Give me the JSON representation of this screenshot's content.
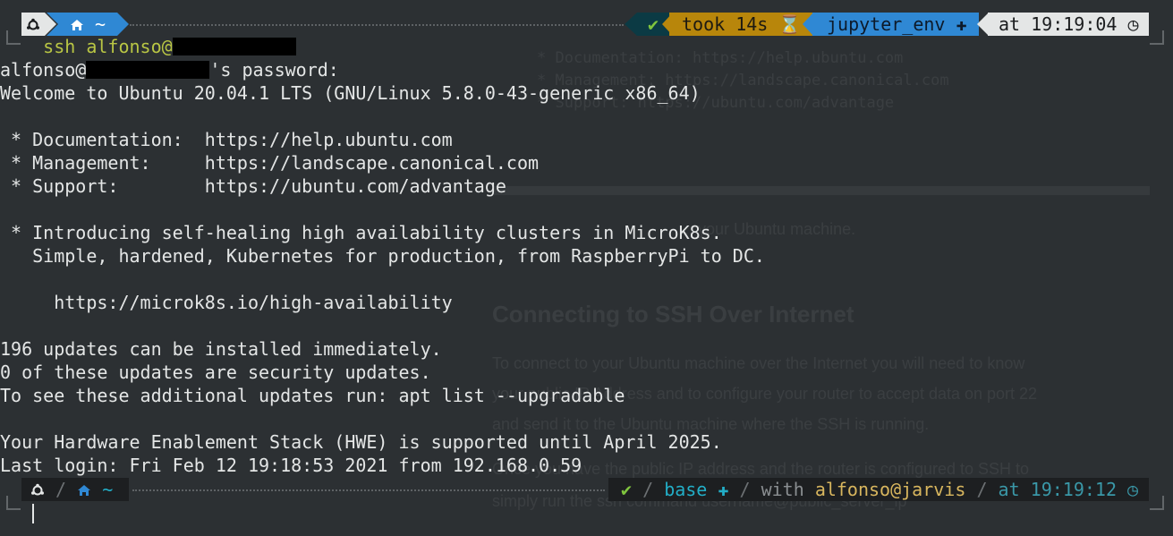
{
  "prompt_top": {
    "os_icon": "ubuntu-icon",
    "home_icon": "home-icon",
    "cwd": "~",
    "status_mark": "✔",
    "took_label": "took 14s",
    "hourglass_icon": "⌛",
    "env_name": "jupyter_env",
    "python_icon": "✚",
    "time_label": "at 19:19:04",
    "clock_icon": "◷"
  },
  "command": {
    "text": "ssh alfonso@",
    "redacted": true
  },
  "output": {
    "password_prefix": "alfonso@",
    "password_suffix": "'s password:",
    "welcome": "Welcome to Ubuntu 20.04.1 LTS (GNU/Linux 5.8.0-43-generic x86_64)",
    "links": [
      {
        "label": " * Documentation:  ",
        "url": "https://help.ubuntu.com"
      },
      {
        "label": " * Management:     ",
        "url": "https://landscape.canonical.com"
      },
      {
        "label": " * Support:        ",
        "url": "https://ubuntu.com/advantage"
      }
    ],
    "intro_1": " * Introducing self-healing high availability clusters in MicroK8s.",
    "intro_2": "   Simple, hardened, Kubernetes for production, from RaspberryPi to DC.",
    "intro_url": "     https://microk8s.io/high-availability",
    "updates_1": "196 updates can be installed immediately.",
    "updates_2": "0 of these updates are security updates.",
    "updates_3": "To see these additional updates run: apt list --upgradable",
    "hwe": "Your Hardware Enablement Stack (HWE) is supported until April 2025.",
    "last_login": "Last login: Fri Feb 12 19:18:53 2021 from 192.168.0.59"
  },
  "prompt_bottom": {
    "cwd": "~",
    "status_mark": "✔",
    "env_name": "base",
    "python_icon": "✚",
    "with_label": "with",
    "user_host": "alfonso@jarvis",
    "time_label": "at 19:19:12",
    "clock_icon": "◷"
  },
  "background_page": {
    "lines": [
      "* Documentation:  https://help.ubuntu.com",
      "* Management:     https://landscape.canonical.com",
      "* Support:        https://ubuntu.com/advantage",
      "... your Ubuntu machine.",
      "Connecting to SSH Over Internet",
      "To connect to your Ubuntu machine over the Internet you will need to know",
      "your public IP Address and to configure your router to accept data on port 22",
      "and send it to the Ubuntu machine where the SSH is running.",
      "Once you have the public IP address and the router is configured to SSH to",
      "simply run the ssh command  username@public_server_ip"
    ]
  },
  "colors": {
    "background": "#2c3033",
    "foreground": "#e4e6e6",
    "command": "#b9c644",
    "accent_blue": "#2f88d4",
    "accent_gold": "#b8860b",
    "ok_green": "#7fc43e"
  }
}
